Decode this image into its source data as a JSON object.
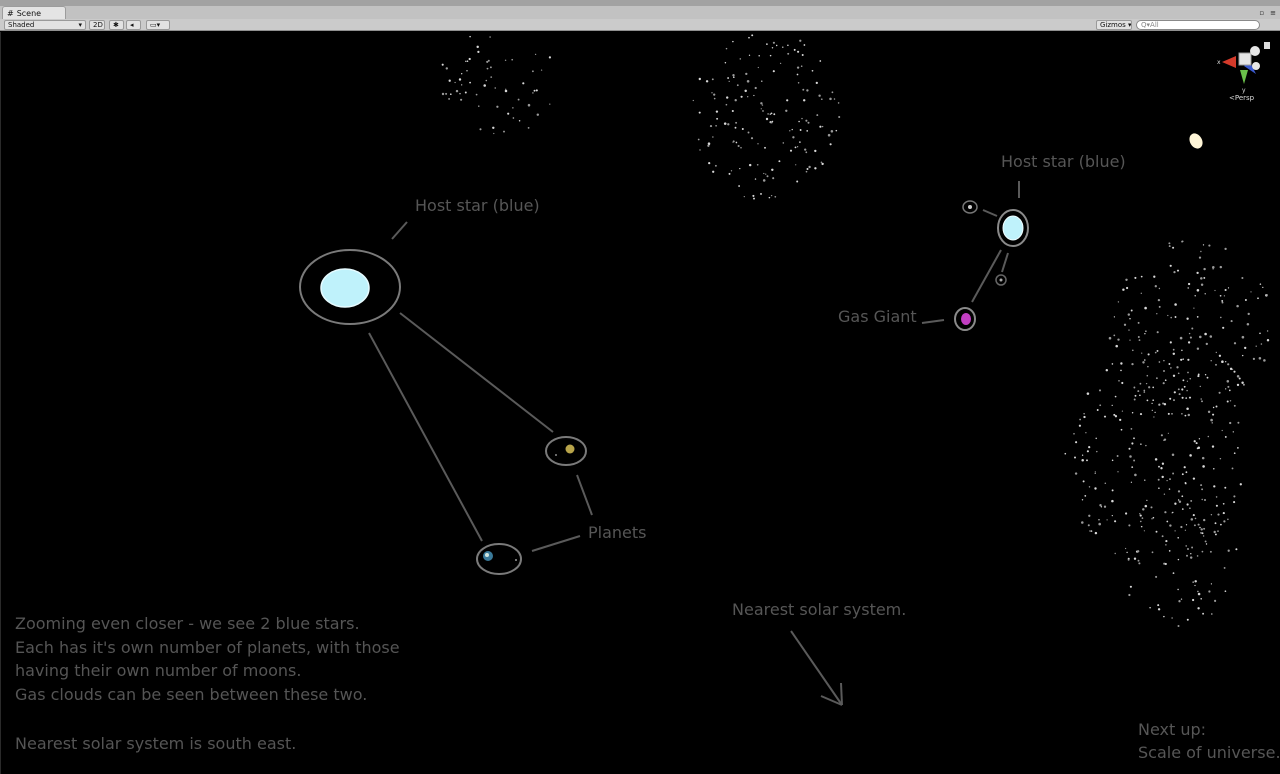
{
  "window": {
    "tab_title": "Scene",
    "tab_icon": "hash-icon"
  },
  "toolbar": {
    "shading_mode": "Shaded",
    "view_2d": "2D",
    "gizmos_label": "Gizmos",
    "search_placeholder": "All"
  },
  "gizmo": {
    "projection": "Persp",
    "axis_y": "y",
    "axis_x": "x"
  },
  "labels": {
    "host_star_left": "Host star (blue)",
    "host_star_right": "Host star (blue)",
    "gas_giant": "Gas Giant",
    "planets": "Planets",
    "nearest_system": "Nearest solar system.",
    "next_up_1": "Next up:",
    "next_up_2": "Scale of universe."
  },
  "description": {
    "line1": "Zooming even closer - we see 2 blue stars.",
    "line2": "Each has it's own number of planets, with those",
    "line3": "having their own number of moons.",
    "line4": "Gas clouds can be seen between these two.",
    "line5": "Nearest solar system is south east."
  },
  "colors": {
    "background": "#000000",
    "annotation_gray": "#565656",
    "star_blue": "#bff2fb",
    "gas_giant_magenta": "#c23ec2",
    "toolbar_gray": "#cbcbcb"
  }
}
